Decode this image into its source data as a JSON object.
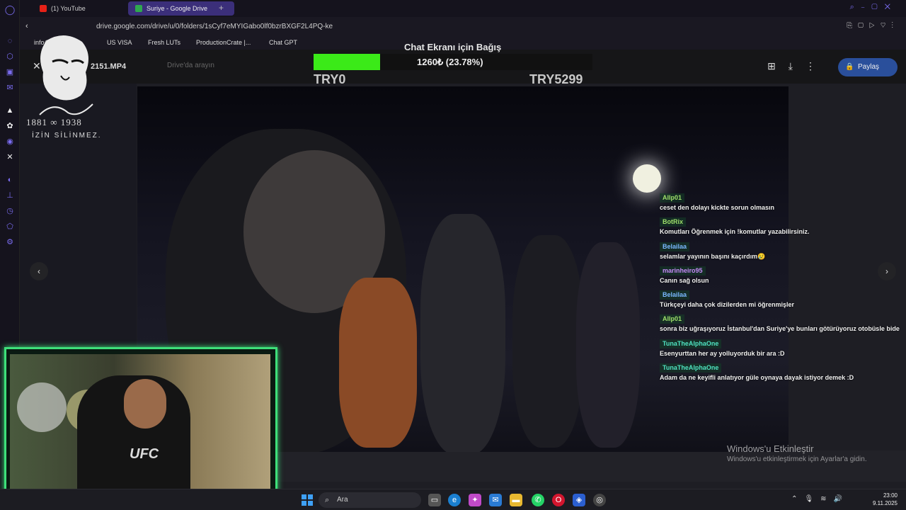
{
  "browser": {
    "tabs": [
      {
        "label": "(1) YouTube",
        "active": false
      },
      {
        "label": "Suriye - Google Drive",
        "active": true
      }
    ],
    "url": "drive.google.com/drive/u/0/folders/1sCyf7eMYIGabo0lf0bzrBXGF2L4PQ-ke",
    "bookmarks": [
      "info@istanbulb...",
      "US VISA",
      "Fresh LUTs",
      "ProductionCrate |...",
      "Chat GPT"
    ]
  },
  "drive": {
    "file_name": "2151.MP4",
    "search_placeholder": "Drive'da arayın",
    "share_label": "Paylaş"
  },
  "donation": {
    "title": "Chat Ekranı için Bağış",
    "progress_text": "1260₺ (23.78%)",
    "progress_fraction": 0.2378,
    "min_label": "TRY0",
    "max_label": "TRY5299",
    "bar_color": "#3bea18"
  },
  "overlay": {
    "years": "1881 ∞ 1938",
    "caption": "İZİN SİLİNMEZ."
  },
  "chat": [
    {
      "user": "Allp01",
      "color": "#9fe06a",
      "text": "ceset den dolayı kickte sorun olmasın"
    },
    {
      "user": "BotRix",
      "color": "#9fe06a",
      "text": "Komutları Öğrenmek için !komutlar yazabilirsiniz."
    },
    {
      "user": "Belailaa",
      "color": "#7ab8ff",
      "text": "selamlar yayının başını kaçırdım😢"
    },
    {
      "user": "marinheiro95",
      "color": "#c58af9",
      "text": "Canın sağ olsun"
    },
    {
      "user": "Belailaa",
      "color": "#7ab8ff",
      "text": "Türkçeyi daha çok dizilerden mi öğrenmişler"
    },
    {
      "user": "Allp01",
      "color": "#9fe06a",
      "text": "sonra biz uğraşıyoruz İstanbul'dan Suriye'ye bunları götürüyoruz otobüsle bide"
    },
    {
      "user": "TunaTheAlphaOne",
      "color": "#4fe3c1",
      "text": "Esenyurttan her ay yolluyorduk bir ara :D"
    },
    {
      "user": "TunaTheAlphaOne",
      "color": "#4fe3c1",
      "text": "Adam da ne keyifli anlatıyor güle oynaya dayak istiyor demek :D"
    }
  ],
  "webcam": {
    "shirt_text": "UFC"
  },
  "watermark": {
    "title": "Windows'u Etkinleştir",
    "subtitle": "Windows'u etkinleştirmek için Ayarlar'a gidin."
  },
  "taskbar": {
    "search_placeholder": "Ara",
    "time": "23:00",
    "date": "9.11.2025"
  }
}
